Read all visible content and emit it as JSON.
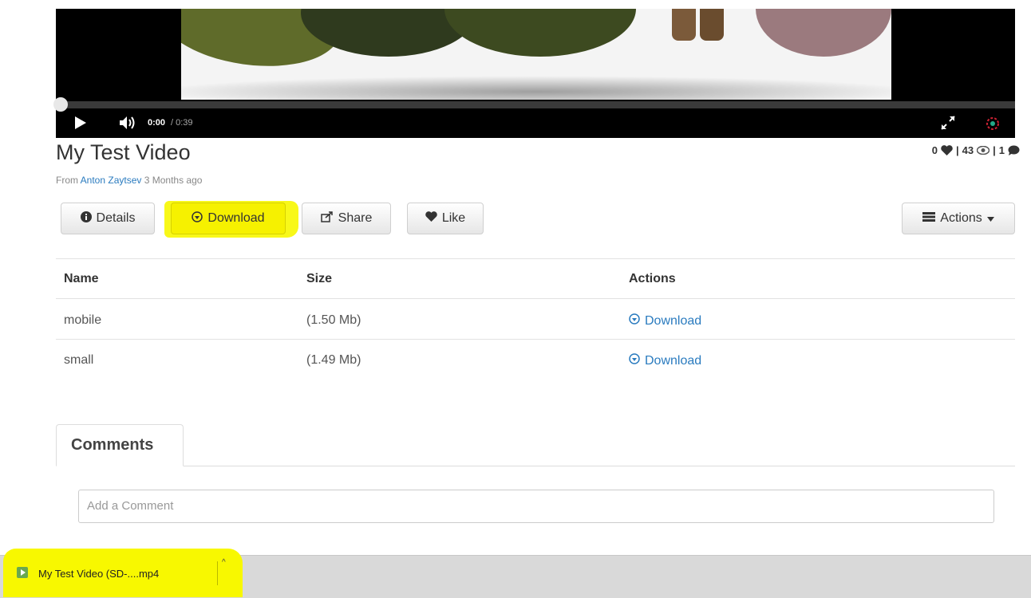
{
  "player": {
    "time_current": "0:00",
    "time_total": "/ 0:39",
    "progress": 0
  },
  "video": {
    "title": "My Test Video",
    "from_label": "From",
    "author": "Anton Zaytsev",
    "age": "3 Months ago",
    "stats": {
      "likes": "0",
      "views": "43",
      "comments": "1",
      "separator": "|"
    }
  },
  "buttons": {
    "details": "Details",
    "download": "Download",
    "share": "Share",
    "like": "Like",
    "actions": "Actions"
  },
  "files_table": {
    "headers": [
      "Name",
      "Size",
      "Actions"
    ],
    "rows": [
      {
        "name": "mobile",
        "size": "(1.50 Mb)",
        "action": "Download"
      },
      {
        "name": "small",
        "size": "(1.49 Mb)",
        "action": "Download"
      }
    ]
  },
  "comments": {
    "tab_label": "Comments",
    "placeholder": "Add a Comment"
  },
  "download_shelf": {
    "filename": "My Test Video (SD-....mp4"
  },
  "colors": {
    "highlight": "#f7f700",
    "link": "#2a7bbf",
    "player_bg": "#000000",
    "shelf_bg": "#d9d9d9"
  }
}
